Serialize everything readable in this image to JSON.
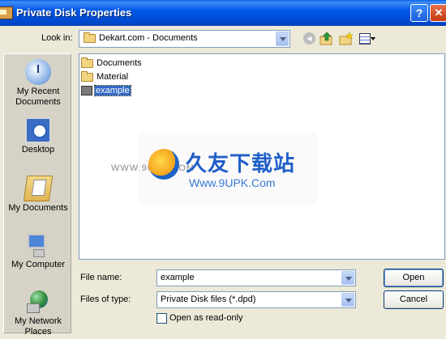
{
  "window": {
    "title": "Private Disk Properties"
  },
  "title_buttons": {
    "help": "?",
    "close": "✕"
  },
  "lookin": {
    "label": "Look in:",
    "value": "Dekart.com - Documents"
  },
  "places": [
    {
      "label": "My Recent Documents"
    },
    {
      "label": "Desktop"
    },
    {
      "label": "My Documents"
    },
    {
      "label": "My Computer"
    },
    {
      "label": "My Network Places"
    }
  ],
  "files": [
    {
      "name": "Documents",
      "icon": "folder-icon"
    },
    {
      "name": "Material",
      "icon": "folder-icon"
    },
    {
      "name": "example",
      "icon": "private-disk-file-icon",
      "selected": true
    }
  ],
  "watermark": {
    "title": "久友下载站",
    "url": "Www.9UPK.Com",
    "prefix": "WWW.9UPK.COM"
  },
  "filename": {
    "label": "File name:",
    "value": "example"
  },
  "filetype": {
    "label": "Files of type:",
    "value": "Private Disk files (*.dpd)"
  },
  "readonly": {
    "label": "Open as read-only",
    "checked": false
  },
  "buttons": {
    "open": "Open",
    "cancel": "Cancel"
  }
}
